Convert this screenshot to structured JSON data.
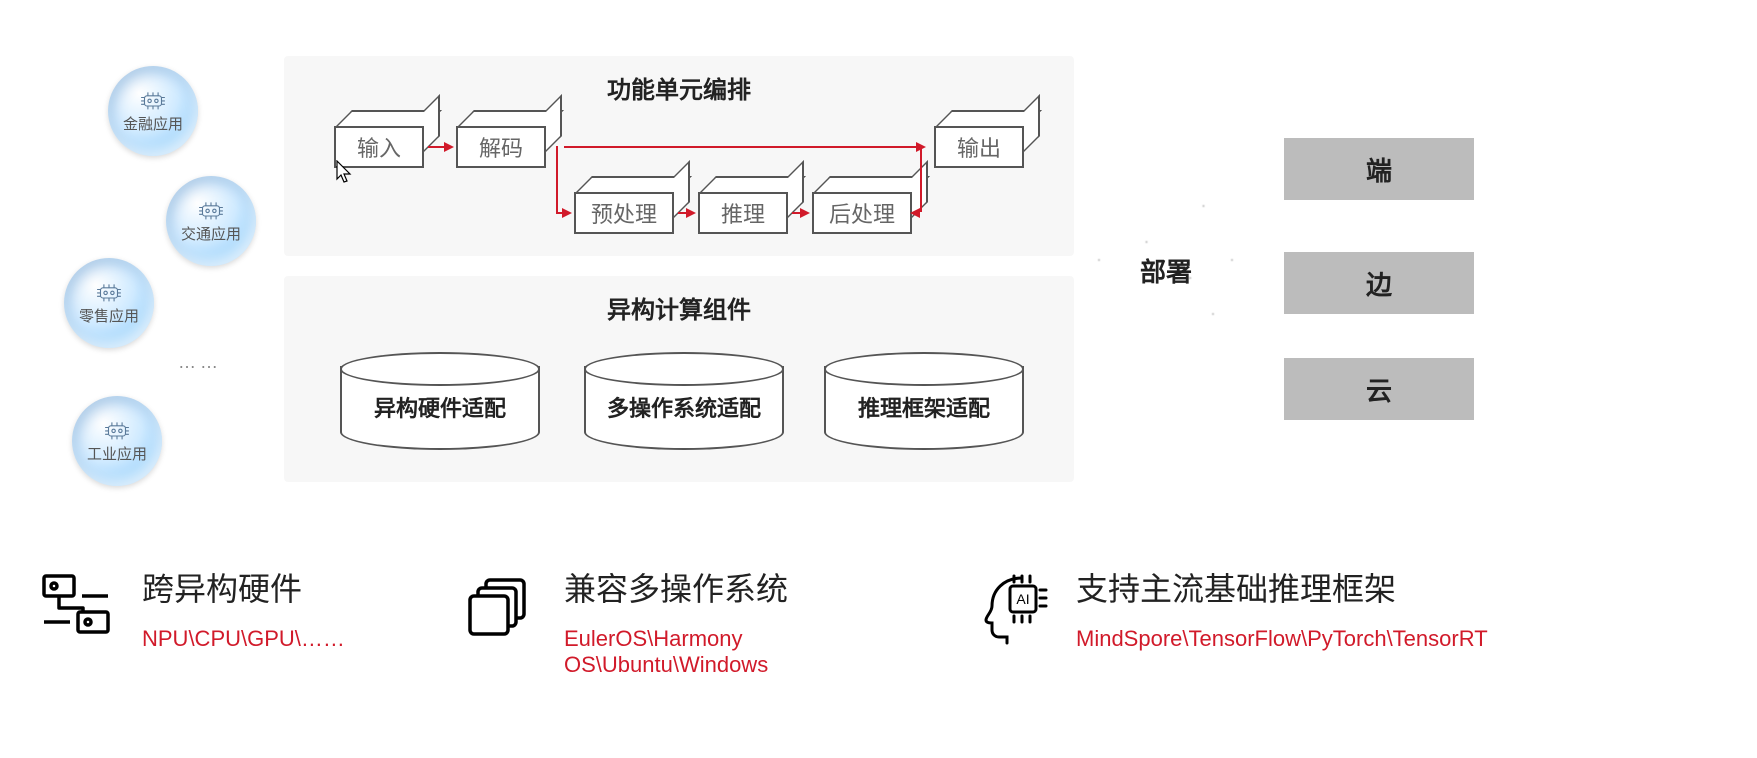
{
  "bubbles": {
    "finance": "金融应用",
    "traffic": "交通应用",
    "retail": "零售应用",
    "industry": "工业应用",
    "ellipsis": "……"
  },
  "orchestration": {
    "title": "功能单元编排",
    "input": "输入",
    "decode": "解码",
    "preprocess": "预处理",
    "infer": "推理",
    "postprocess": "后处理",
    "output": "输出"
  },
  "hetero": {
    "title": "异构计算组件",
    "hw": "异构硬件适配",
    "os": "多操作系统适配",
    "fw": "推理框架适配"
  },
  "deploy": {
    "label": "部署",
    "device": "端",
    "edge": "边",
    "cloud": "云"
  },
  "features": {
    "hw": {
      "title": "跨异构硬件",
      "sub": "NPU\\CPU\\GPU\\……"
    },
    "os": {
      "title": "兼容多操作系统",
      "sub": "EulerOS\\Harmony OS\\Ubuntu\\Windows"
    },
    "fw": {
      "title": "支持主流基础推理框架",
      "sub": "MindSpore\\TensorFlow\\PyTorch\\TensorRT"
    }
  }
}
